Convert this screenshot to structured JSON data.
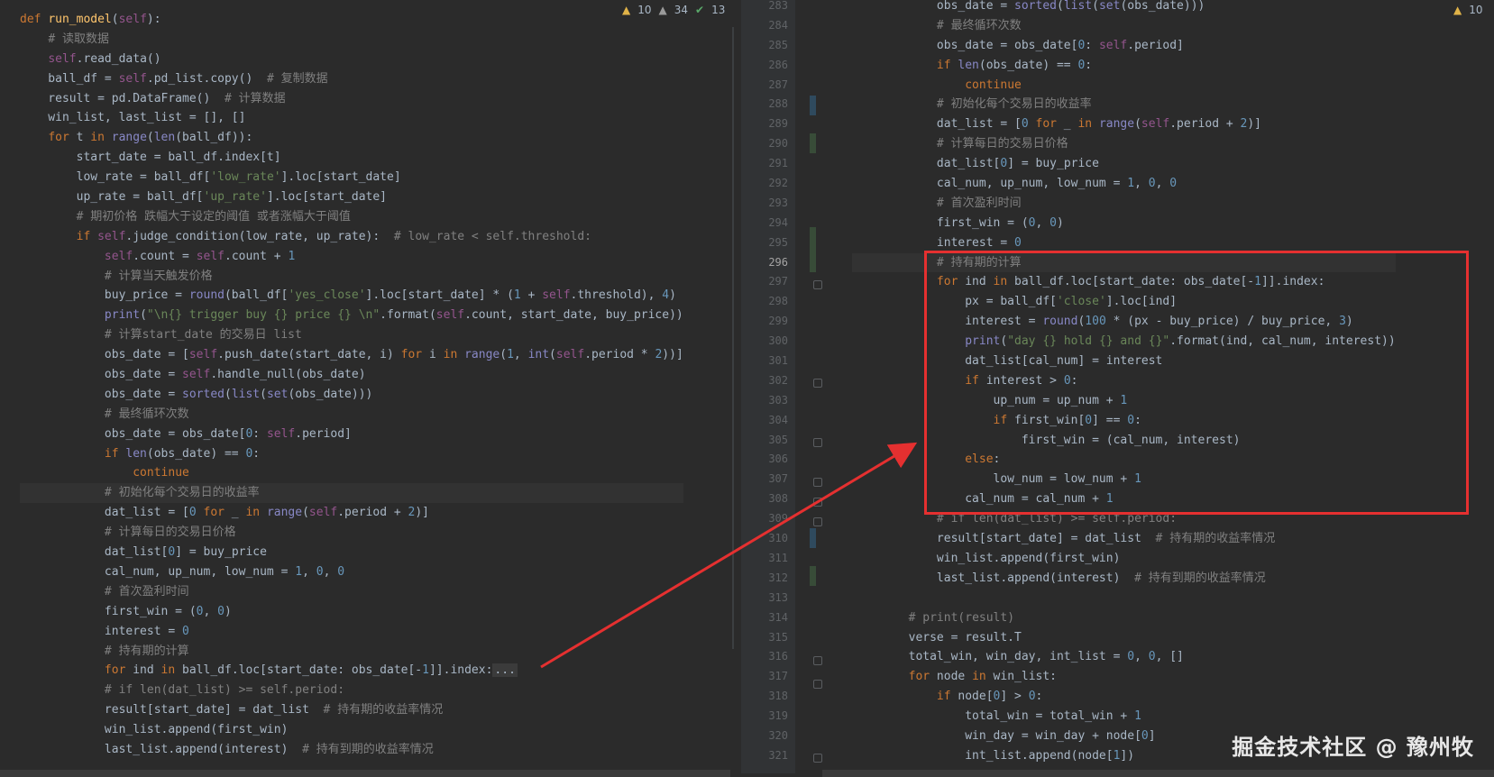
{
  "left_editor": {
    "inspections": {
      "warnings_a": "10",
      "warnings_b": "34",
      "checks": "13"
    },
    "lines": [
      "def run_model(self):",
      "    # 读取数据",
      "    self.read_data()",
      "    ball_df = self.pd_list.copy()  # 复制数据",
      "    result = pd.DataFrame()  # 计算数据",
      "    win_list, last_list = [], []",
      "    for t in range(len(ball_df)):",
      "        start_date = ball_df.index[t]",
      "        low_rate = ball_df['low_rate'].loc[start_date]",
      "        up_rate = ball_df['up_rate'].loc[start_date]",
      "        # 期初价格 跌幅大于设定的阈值 或者涨幅大于阈值",
      "        if self.judge_condition(low_rate, up_rate):  # low_rate < self.threshold:",
      "            self.count = self.count + 1",
      "            # 计算当天触发价格",
      "            buy_price = round(ball_df['yes_close'].loc[start_date] * (1 + self.threshold), 4)",
      "            print(\"\\n{} trigger buy {} price {} \\n\".format(self.count, start_date, buy_price))",
      "            # 计算start_date 的交易日 list",
      "            obs_date = [self.push_date(start_date, i) for i in range(1, int(self.period * 2))]",
      "            obs_date = self.handle_null(obs_date)",
      "            obs_date = sorted(list(set(obs_date)))",
      "            # 最终循环次数",
      "            obs_date = obs_date[0: self.period]",
      "            if len(obs_date) == 0:",
      "                continue",
      "            # 初始化每个交易日的收益率",
      "            dat_list = [0 for _ in range(self.period + 2)]",
      "            # 计算每日的交易日价格",
      "            dat_list[0] = buy_price",
      "            cal_num, up_num, low_num = 1, 0, 0",
      "            # 首次盈利时间",
      "            first_win = (0, 0)",
      "            interest = 0",
      "            # 持有期的计算",
      "            for ind in ball_df.loc[start_date: obs_date[-1]].index:...",
      "            # if len(dat_list) >= self.period:",
      "            result[start_date] = dat_list  # 持有期的收益率情况",
      "            win_list.append(first_win)",
      "            last_list.append(interest)  # 持有到期的收益率情况"
    ]
  },
  "right_editor": {
    "inspections": {
      "warnings_a": "10"
    },
    "line_numbers": [
      "283",
      "284",
      "285",
      "286",
      "287",
      "288",
      "289",
      "290",
      "291",
      "292",
      "293",
      "294",
      "295",
      "296",
      "297",
      "298",
      "299",
      "300",
      "301",
      "302",
      "303",
      "304",
      "305",
      "306",
      "307",
      "308",
      "309",
      "310",
      "311",
      "312",
      "313",
      "314",
      "315",
      "316",
      "317",
      "318",
      "319",
      "320",
      "321"
    ],
    "lines": [
      "            obs_date = sorted(list(set(obs_date)))",
      "            # 最终循环次数",
      "            obs_date = obs_date[0: self.period]",
      "            if len(obs_date) == 0:",
      "                continue",
      "            # 初始化每个交易日的收益率",
      "            dat_list = [0 for _ in range(self.period + 2)]",
      "            # 计算每日的交易日价格",
      "            dat_list[0] = buy_price",
      "            cal_num, up_num, low_num = 1, 0, 0",
      "            # 首次盈利时间",
      "            first_win = (0, 0)",
      "            interest = 0",
      "            # 持有期的计算",
      "            for ind in ball_df.loc[start_date: obs_date[-1]].index:",
      "                px = ball_df['close'].loc[ind]",
      "                interest = round(100 * (px - buy_price) / buy_price, 3)",
      "                print(\"day {} hold {} and {}\".format(ind, cal_num, interest))",
      "                dat_list[cal_num] = interest",
      "                if interest > 0:",
      "                    up_num = up_num + 1",
      "                    if first_win[0] == 0:",
      "                        first_win = (cal_num, interest)",
      "                else:",
      "                    low_num = low_num + 1",
      "                cal_num = cal_num + 1",
      "            # if len(dat_list) >= self.period:",
      "            result[start_date] = dat_list  # 持有期的收益率情况",
      "            win_list.append(first_win)",
      "            last_list.append(interest)  # 持有到期的收益率情况",
      "",
      "        # print(result)",
      "        verse = result.T",
      "        total_win, win_day, int_list = 0, 0, []",
      "        for node in win_list:",
      "            if node[0] > 0:",
      "                total_win = total_win + 1",
      "                win_day = win_day + node[0]",
      "                int_list.append(node[1])"
    ]
  },
  "watermark": "掘金技术社区 @ 豫州牧"
}
